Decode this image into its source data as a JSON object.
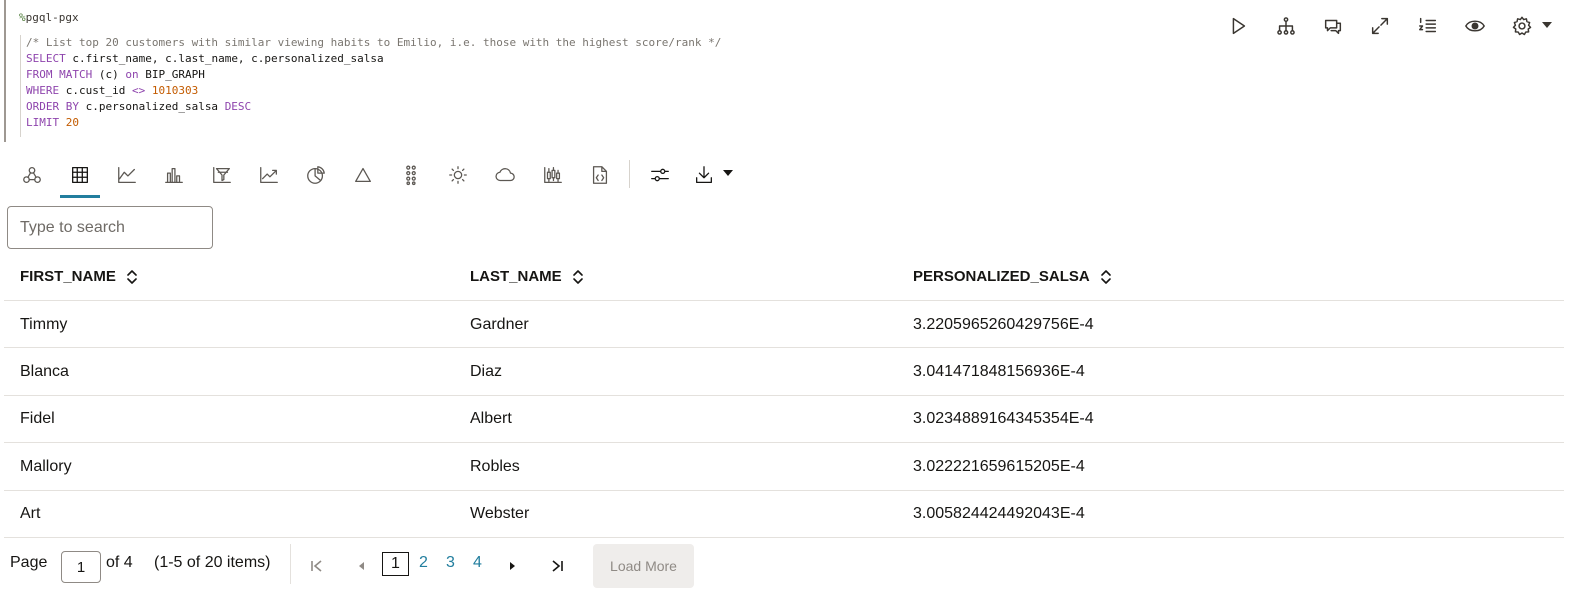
{
  "cell": {
    "magic_prefix": "%",
    "magic_name": "pgql-pgx",
    "code": {
      "comment": "/* List top 20 customers with similar viewing habits to Emilio, i.e. those with the highest score/rank */",
      "select_kw": "SELECT",
      "select_cols": " c.first_name, c.last_name, c.personalized_salsa",
      "from_kw": "FROM MATCH",
      "from_rest_a": " (c) ",
      "from_on": "on",
      "from_rest_b": " BIP_GRAPH",
      "where_kw": "WHERE",
      "where_rest": " c.cust_id ",
      "where_op": "<>",
      "where_val": "1010303",
      "order_kw": "ORDER BY",
      "order_rest": " c.personalized_salsa ",
      "order_dir": "DESC",
      "limit_kw": "LIMIT",
      "limit_val": "20"
    }
  },
  "cell_actions": [
    "run-icon",
    "graph-structure-icon",
    "comments-icon",
    "expand-icon",
    "numbered-list-icon",
    "eye-icon",
    "gear-icon"
  ],
  "viz_toolbar": {
    "items": [
      "graph-icon",
      "table-icon",
      "area-chart-icon",
      "bar-chart-icon",
      "funnel-chart-icon",
      "line-chart-icon",
      "pie-chart-icon",
      "pyramid-icon",
      "scatter-icon",
      "sunburst-icon",
      "tag-cloud-icon",
      "box-plot-icon",
      "code-view-icon",
      "settings-sliders-icon",
      "download-icon"
    ],
    "active": "table-icon"
  },
  "search": {
    "placeholder": "Type to search",
    "value": ""
  },
  "table": {
    "columns": [
      "FIRST_NAME",
      "LAST_NAME",
      "PERSONALIZED_SALSA"
    ],
    "rows": [
      [
        "Timmy",
        "Gardner",
        "3.2205965260429756E-4"
      ],
      [
        "Blanca",
        "Diaz",
        "3.041471848156936E-4"
      ],
      [
        "Fidel",
        "Albert",
        "3.0234889164345354E-4"
      ],
      [
        "Mallory",
        "Robles",
        "3.022221659615205E-4"
      ],
      [
        "Art",
        "Webster",
        "3.005824424492043E-4"
      ]
    ]
  },
  "pagination": {
    "page_label": "Page",
    "current_page": "1",
    "of_label": "of 4",
    "items_label": "(1-5 of 20 items)",
    "pages": [
      "1",
      "2",
      "3",
      "4"
    ],
    "load_more": "Load More"
  },
  "colors": {
    "accent": "#227e9e",
    "text": "#161513",
    "border": "#e4e1dd"
  }
}
